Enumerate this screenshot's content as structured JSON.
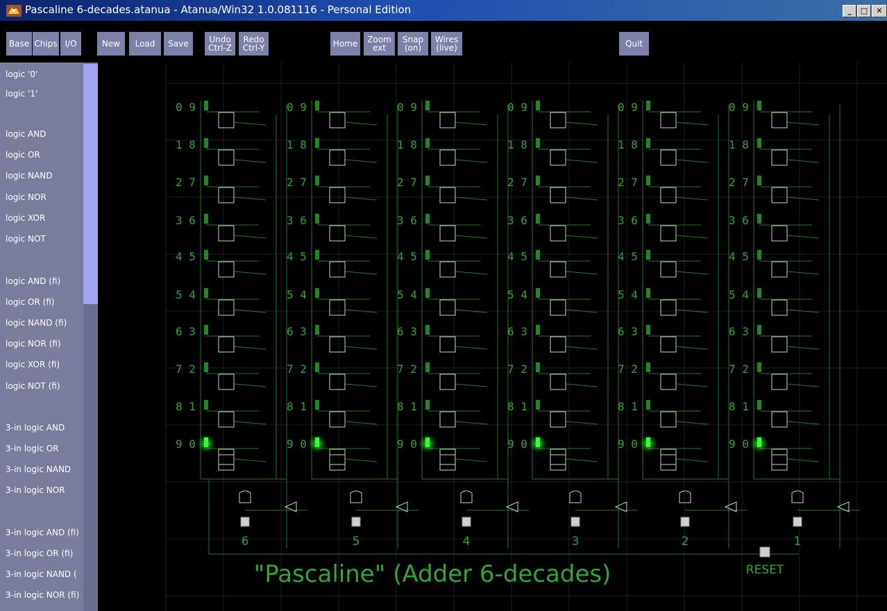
{
  "window": {
    "title": "Pascaline 6-decades.atanua - Atanua/Win32 1.0.081116 - Personal Edition",
    "controls": [
      "minimize",
      "maximize",
      "close"
    ]
  },
  "toolbar": {
    "base": "Base",
    "chips": "Chips",
    "io": "I/O",
    "new": "New",
    "load": "Load",
    "save": "Save",
    "undo": "Undo\nCtrl-Z",
    "redo": "Redo\nCtrl-Y",
    "home": "Home",
    "zoom": "Zoom\next",
    "snap": "Snap\n(on)",
    "wires": "Wires\n(live)",
    "quit": "Quit"
  },
  "sidebar": {
    "items": [
      "logic '0'",
      "logic '1'",
      "logic AND",
      "logic OR",
      "logic NAND",
      "logic NOR",
      "logic XOR",
      "logic NOT",
      "logic AND (fi)",
      "logic OR (fi)",
      "logic NAND (fi)",
      "logic NOR (fi)",
      "logic XOR (fi)",
      "logic NOT (fi)",
      "3-in logic AND",
      "3-in logic OR",
      "3-in logic NAND",
      "3-in logic NOR",
      "3-in logic AND (fi)",
      "3-in logic OR (fi)",
      "3-in logic NAND (",
      "3-in logic NOR (fi)"
    ]
  },
  "circuit": {
    "title": "\"Pascaline\" (Adder 6-decades)",
    "reset_label": "RESET",
    "decade_labels": [
      "6",
      "5",
      "4",
      "3",
      "2",
      "1"
    ],
    "digit_pairs": [
      "0 9",
      "1 8",
      "2 7",
      "3 6",
      "4 5",
      "5 4",
      "6 3",
      "7 2",
      "8 1",
      "9 0"
    ],
    "active_digit_row": 9,
    "colors": {
      "wire": "#1f7a1f",
      "digit": "#2fa32f",
      "led_on": "#33ff33",
      "led_off": "#1e8a1e",
      "chip": "#cfcfcf",
      "grid": "#1e1e1e"
    }
  }
}
